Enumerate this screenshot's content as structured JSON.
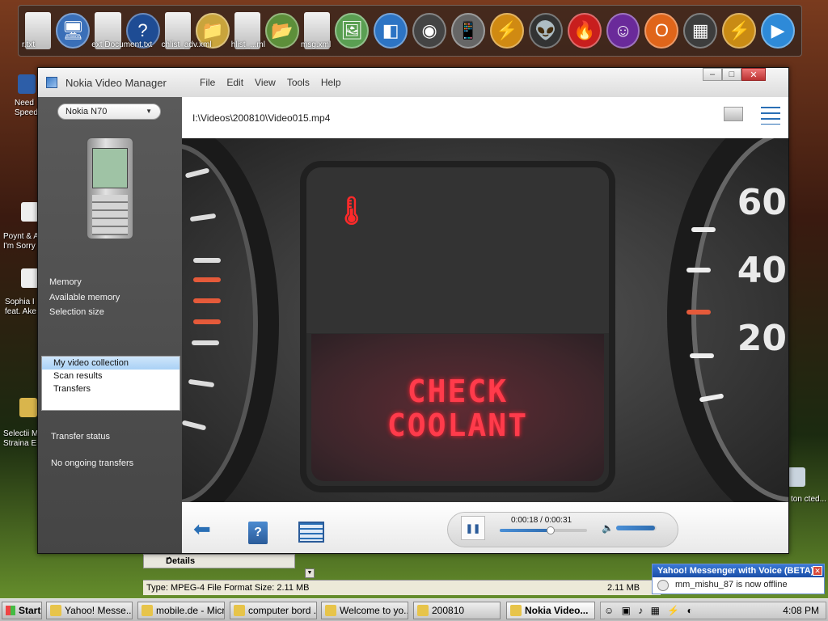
{
  "window": {
    "title": "Nokia Video Manager",
    "menu": [
      "File",
      "Edit",
      "View",
      "Tools",
      "Help"
    ],
    "controls": {
      "minimize": "–",
      "maximize": "□",
      "close": "✕"
    }
  },
  "sidebar": {
    "device": "Nokia N70",
    "info": [
      "Memory",
      "Available memory",
      "Selection size"
    ],
    "nav": [
      "My video collection",
      "Scan results",
      "Transfers"
    ],
    "transfer_status_label": "Transfer status",
    "transfer_status_value": "No ongoing transfers"
  },
  "content": {
    "path": "I:\\Videos\\200810\\Video015.mp4",
    "video_text": {
      "line1": "CHECK",
      "line2": "COOLANT",
      "gauge_numbers": [
        "60",
        "40",
        "20"
      ]
    },
    "player": {
      "time": "0:00:18 / 0:00:31",
      "progress_fraction": 0.58,
      "volume_fraction": 0.95
    }
  },
  "desktop": {
    "dock_labels": [
      "r.txt",
      "ext Document.txt",
      "chlist_adv.xml",
      "hlist_...ml",
      "msg.xml"
    ],
    "left_labels": [
      "Need Speed",
      "Poynt & A I'm Sorry",
      "Sophia I feat. Ake",
      "Selectii M Straina E"
    ],
    "right_labels": [
      "ton cted..."
    ]
  },
  "explorer": {
    "details_label": "Details",
    "status_text": "Type: MPEG-4 File Format Size: 2.11 MB",
    "status_size": "2.11 MB"
  },
  "notification": {
    "title": "Yahoo! Messenger with Voice (BETA)",
    "message": "mm_mishu_87 is now offline"
  },
  "taskbar": {
    "start": "Start",
    "tasks": [
      "Yahoo! Messe...",
      "mobile.de - Micr...",
      "computer bord ...",
      "Welcome to yo...",
      "200810",
      "Nokia Video..."
    ],
    "active_task_index": 5,
    "clock": "4:08 PM"
  }
}
